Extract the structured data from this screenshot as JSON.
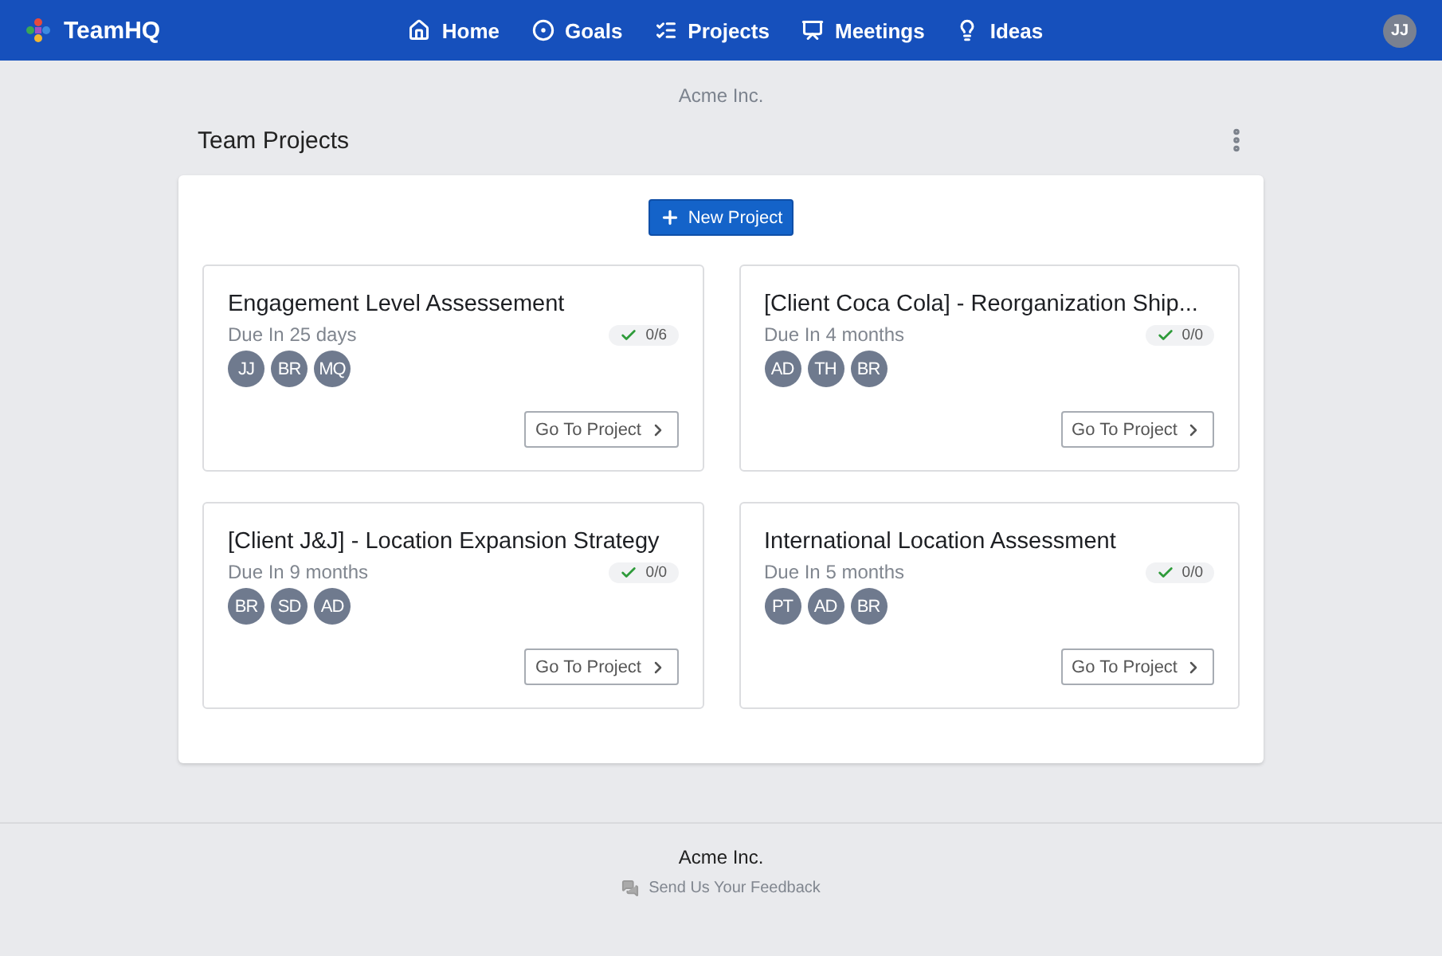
{
  "brand": {
    "name": "TeamHQ"
  },
  "nav": [
    {
      "kind": "home",
      "label": "Home"
    },
    {
      "kind": "goals",
      "label": "Goals"
    },
    {
      "kind": "projects",
      "label": "Projects"
    },
    {
      "kind": "meetings",
      "label": "Meetings"
    },
    {
      "kind": "ideas",
      "label": "Ideas"
    }
  ],
  "user": {
    "initials": "JJ"
  },
  "organization": "Acme Inc.",
  "section": {
    "title": "Team Projects"
  },
  "new_project_button": "New Project",
  "projects": [
    {
      "title": "Engagement Level Assessement",
      "due": "Due In 25 days",
      "tasks": "0/6",
      "members": [
        "JJ",
        "BR",
        "MQ"
      ],
      "action": "Go To Project"
    },
    {
      "title": "[Client Coca Cola] - Reorganization Ship...",
      "due": "Due In 4 months",
      "tasks": "0/0",
      "members": [
        "AD",
        "TH",
        "BR"
      ],
      "action": "Go To Project"
    },
    {
      "title": "[Client J&J] - Location Expansion Strategy",
      "due": "Due In 9 months",
      "tasks": "0/0",
      "members": [
        "BR",
        "SD",
        "AD"
      ],
      "action": "Go To Project"
    },
    {
      "title": "International Location Assessment",
      "due": "Due In 5 months",
      "tasks": "0/0",
      "members": [
        "PT",
        "AD",
        "BR"
      ],
      "action": "Go To Project"
    }
  ],
  "footer": {
    "company": "Acme Inc.",
    "feedback": "Send Us Your Feedback"
  }
}
